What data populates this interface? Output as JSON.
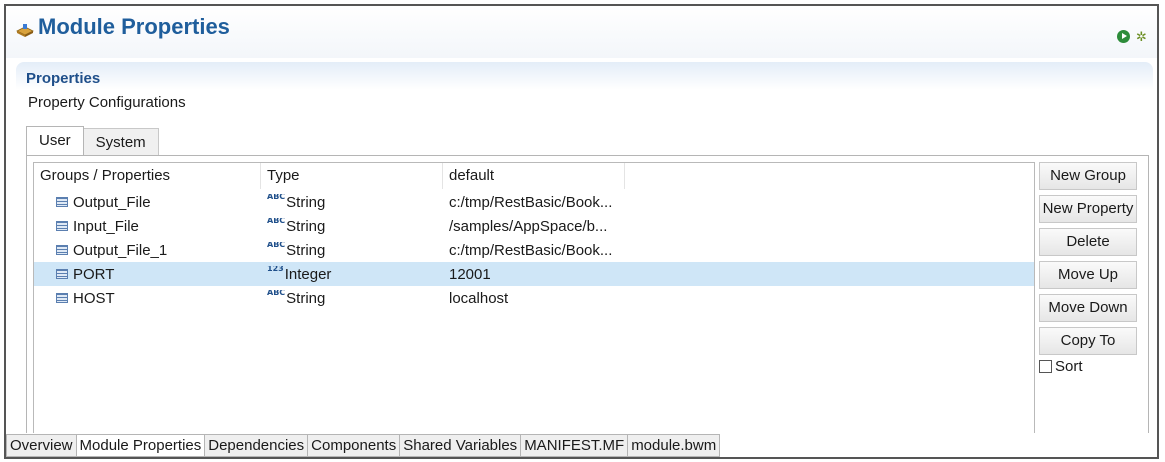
{
  "header": {
    "title": "Module Properties",
    "title_icon": "module-icon",
    "right_icons": [
      "run-icon",
      "gear-icon"
    ]
  },
  "section": {
    "title": "Properties",
    "subtitle": "Property Configurations"
  },
  "tabs": [
    {
      "label": "User",
      "active": true
    },
    {
      "label": "System",
      "active": false
    }
  ],
  "table": {
    "columns": [
      "Groups / Properties",
      "Type",
      "default"
    ],
    "rows": [
      {
        "name": "Output_File",
        "type_icon": "ABC",
        "type": "String",
        "default": "c:/tmp/RestBasic/Book...",
        "selected": false
      },
      {
        "name": "Input_File",
        "type_icon": "ABC",
        "type": "String",
        "default": "/samples/AppSpace/b...",
        "selected": false
      },
      {
        "name": "Output_File_1",
        "type_icon": "ABC",
        "type": "String",
        "default": "c:/tmp/RestBasic/Book...",
        "selected": false
      },
      {
        "name": "PORT",
        "type_icon": "123",
        "type": "Integer",
        "default": "12001",
        "selected": true
      },
      {
        "name": "HOST",
        "type_icon": "ABC",
        "type": "String",
        "default": "localhost",
        "selected": false
      }
    ]
  },
  "buttons": {
    "new_group": "New Group",
    "new_property": "New Property",
    "delete": "Delete",
    "move_up": "Move Up",
    "move_down": "Move Down",
    "copy_to": "Copy To",
    "sort_label": "Sort",
    "sort_checked": false
  },
  "bottom_tabs": [
    {
      "label": "Overview",
      "active": false
    },
    {
      "label": "Module Properties",
      "active": true
    },
    {
      "label": "Dependencies",
      "active": false
    },
    {
      "label": "Components",
      "active": false
    },
    {
      "label": "Shared Variables",
      "active": false
    },
    {
      "label": "MANIFEST.MF",
      "active": false
    },
    {
      "label": "module.bwm",
      "active": false
    }
  ],
  "colors": {
    "title": "#1f5e9c",
    "section_title": "#1f4f8a",
    "selected_row": "#cfe6f7"
  }
}
